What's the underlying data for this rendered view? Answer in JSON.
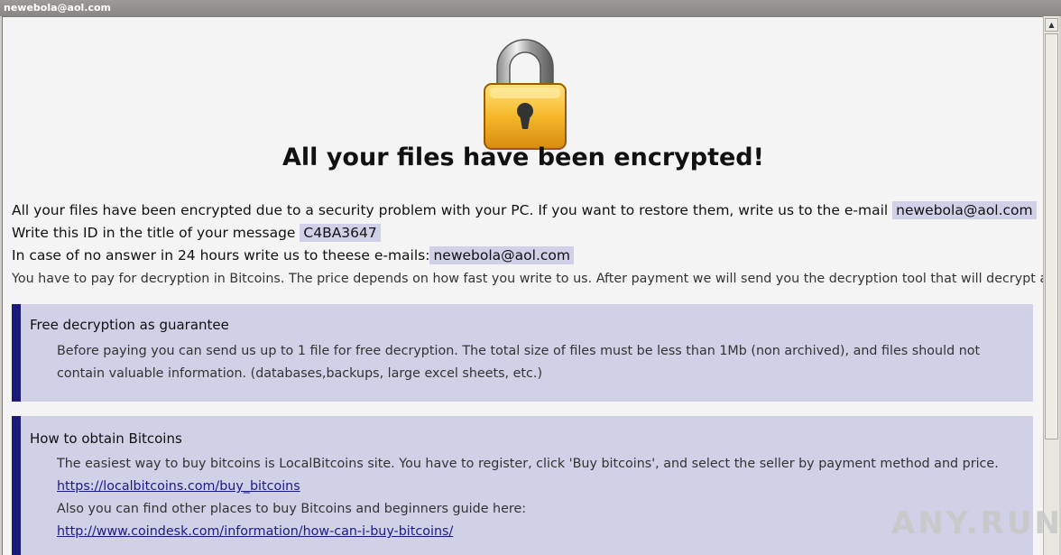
{
  "window": {
    "title": "newebola@aol.com"
  },
  "main": {
    "headline": "All your files have been encrypted!",
    "line1": "All your files have been encrypted due to a security problem with your PC. If you want to restore them, write us to the e-mail",
    "line1_email": "newebola@aol.com",
    "line2": "Write this ID in the title of your message",
    "line2_id": "C4BA3647",
    "line3": "In case of no answer in 24 hours write us to theese e-mails:",
    "line3_email": "newebola@aol.com",
    "line4": "You have to pay for decryption in Bitcoins. The price depends on how fast you write to us. After payment we will send you the decryption tool that will decrypt all your files."
  },
  "guarantee": {
    "title": "Free decryption as guarantee",
    "text": "Before paying you can send us up to 1 file for free decryption. The total size of files must be less than 1Mb (non archived), and files should not contain valuable information. (databases,backups, large excel sheets, etc.)"
  },
  "bitcoins": {
    "title": "How to obtain Bitcoins",
    "text1": "The easiest way to buy bitcoins is LocalBitcoins site. You have to register, click 'Buy bitcoins', and select the seller by payment method and price.",
    "link1": "https://localbitcoins.com/buy_bitcoins",
    "text2": "Also you can find other places to buy Bitcoins and beginners guide here:",
    "link2": "http://www.coindesk.com/information/how-can-i-buy-bitcoins/"
  },
  "watermark": {
    "text": "ANY.RUN"
  },
  "icons": {
    "lock": "padlock-icon",
    "scroll_up": "arrow-up-icon"
  },
  "colors": {
    "box_bg": "#d0d0e6",
    "box_accent": "#1a1a7a",
    "link": "#1a1a8a",
    "highlight": "#d0d0e8"
  }
}
